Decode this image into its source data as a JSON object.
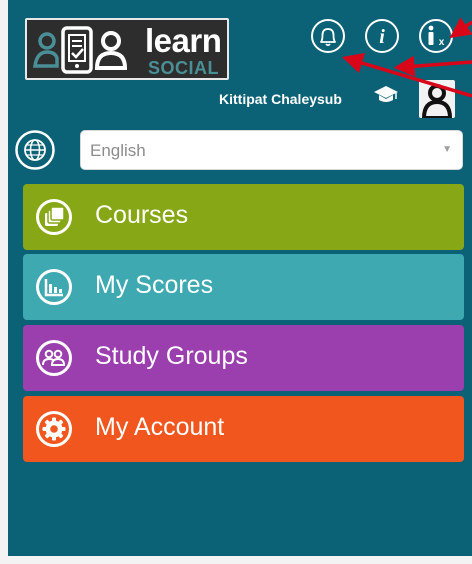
{
  "logo": {
    "word_main": "learn",
    "word_sub": "SOCIAL"
  },
  "header": {
    "icons": [
      "bell-icon",
      "info-icon",
      "accessibility-icon"
    ],
    "user_name": "Kittipat Chaleysub"
  },
  "language": {
    "selected": "English"
  },
  "menu": {
    "items": [
      {
        "label": "Courses",
        "icon": "courses-icon",
        "color": "#87a716"
      },
      {
        "label": "My Scores",
        "icon": "scores-chart-icon",
        "color": "#3fa9b2"
      },
      {
        "label": "Study Groups",
        "icon": "study-groups-icon",
        "color": "#9b3fae"
      },
      {
        "label": "My Account",
        "icon": "gear-icon",
        "color": "#f1561e"
      }
    ]
  },
  "colors": {
    "background": "#0b6175",
    "annotation_arrow": "#d9061a"
  }
}
